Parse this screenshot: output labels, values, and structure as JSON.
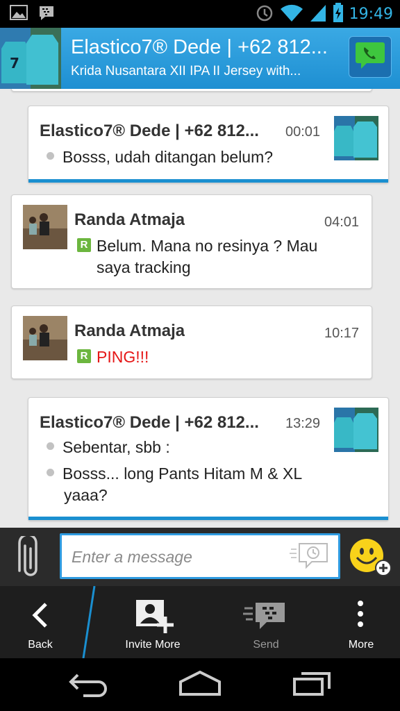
{
  "status_bar": {
    "time": "19:49",
    "icons": [
      "gallery-icon",
      "bbm-notification-icon",
      "alarm-icon",
      "wifi-icon",
      "signal-icon",
      "battery-icon"
    ]
  },
  "header": {
    "title": "Elastico7® Dede | +62 812...",
    "subtitle": "Krida Nusantara XII IPA II Jersey with...",
    "call_icon": "phone-chat-icon"
  },
  "messages": [
    {
      "sender": "Elastico7® Dede | +62 812...",
      "time": "00:01",
      "lines": [
        "Bosss, udah ditangan belum?"
      ]
    },
    {
      "sender": "Randa Atmaja",
      "time": "04:01",
      "lines": [
        "Belum. Mana no resinya ? Mau",
        "saya tracking"
      ]
    },
    {
      "sender": "Randa Atmaja",
      "time": "10:17",
      "lines": [
        "PING!!!"
      ]
    },
    {
      "sender": "Elastico7® Dede | +62 812...",
      "time": "13:29",
      "lines": [
        "Sebentar, sbb :",
        "Bosss... long Pants Hitam M & XL",
        "yaaa?"
      ]
    }
  ],
  "compose": {
    "placeholder": "Enter a message"
  },
  "actions": {
    "back": "Back",
    "invite_more": "Invite More",
    "send": "Send",
    "more": "More"
  },
  "colors": {
    "accent": "#33b5e5",
    "header": "#2a9ad9",
    "ping": "#e51616",
    "read_badge": "#6cb63f"
  }
}
